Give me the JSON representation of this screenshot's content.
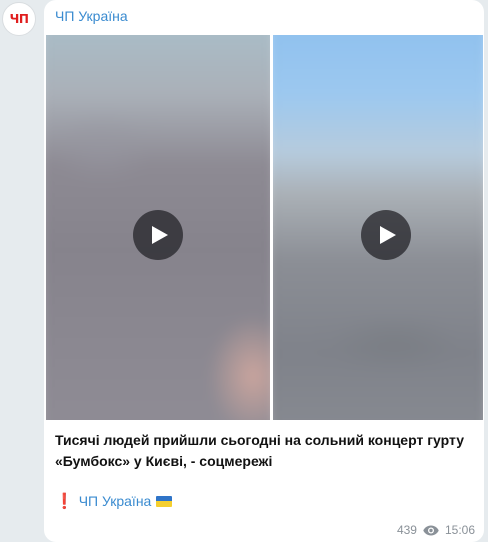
{
  "channel": {
    "avatar_text": "ЧП",
    "name": "ЧП Україна"
  },
  "post": {
    "videos": [
      {
        "name": "video-1",
        "play_icon": "play-icon"
      },
      {
        "name": "video-2",
        "play_icon": "play-icon"
      }
    ],
    "text": "Тисячі людей прийшли сьогодні на сольний концерт гурту «Бумбокс» у Києві, - соцмережі",
    "signature": {
      "exclamation": "❗",
      "channel_link": "ЧП Україна",
      "flag_icon": "ukraine-flag-icon"
    },
    "views": "439",
    "views_icon": "eye-icon",
    "time": "15:06"
  },
  "colors": {
    "link": "#3a8bd0",
    "avatar_text": "#e01e1e",
    "background": "#e6ebee"
  }
}
